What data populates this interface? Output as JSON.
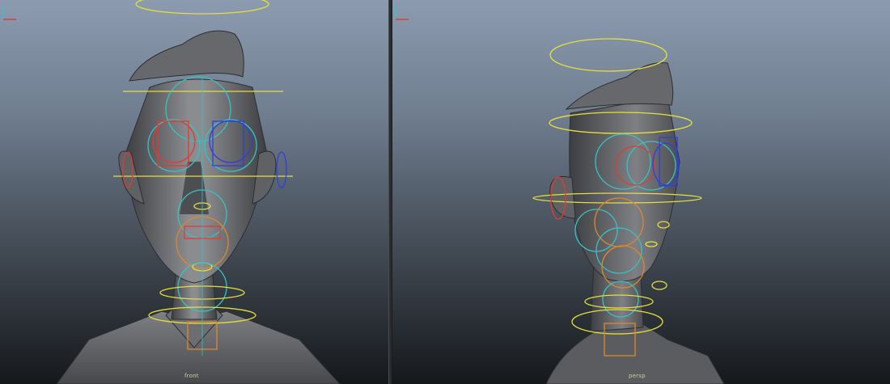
{
  "viewports": {
    "front": {
      "camera_label": "front"
    },
    "perspective": {
      "camera_label": "persp"
    }
  },
  "colors": {
    "mesh": "#5e6064",
    "mesh_highlight": "#8b8d91",
    "control_yellow": "#e5df3c",
    "control_cyan": "#35c3c6",
    "control_red": "#e23a32",
    "control_blue": "#2f3fd8",
    "control_orange": "#e0862e"
  },
  "icons": {
    "axis_gizmo": "xyz-axis-icon"
  }
}
